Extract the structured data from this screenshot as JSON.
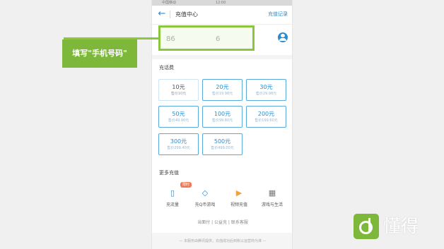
{
  "status": {
    "left": "中国移动",
    "time": "12:00"
  },
  "header": {
    "title": "充值中心",
    "record_label": "充值记录"
  },
  "phone": {
    "value": "86                  6"
  },
  "callout": {
    "label": "填写\"手机号码\"",
    "color": "#8cc63f"
  },
  "recharge": {
    "section_label": "充话费",
    "tiles": [
      {
        "amount": "10元",
        "sub": "售价10元"
      },
      {
        "amount": "20元",
        "sub": "售价19.98元"
      },
      {
        "amount": "30元",
        "sub": "售价29.98元"
      },
      {
        "amount": "50元",
        "sub": "售价49.90元"
      },
      {
        "amount": "100元",
        "sub": "售价99.80元"
      },
      {
        "amount": "200元",
        "sub": "售价199.60元"
      },
      {
        "amount": "300元",
        "sub": "售价299.40元"
      },
      {
        "amount": "500元",
        "sub": "售价499.00元"
      }
    ]
  },
  "more": {
    "section_label": "更多充值",
    "badge": "限时",
    "items": [
      {
        "label": "充流量",
        "icon": "phone-data-icon"
      },
      {
        "label": "充Q币游戏",
        "icon": "q-coin-icon"
      },
      {
        "label": "视频充值",
        "icon": "video-icon"
      },
      {
        "label": "游戏与生活",
        "icon": "grid-icon"
      }
    ]
  },
  "footer": {
    "links": "当面付 | 公益充 | 联系客服",
    "note": "— 本服务由腾讯提供，充值成功后到账以运营商为准 —"
  },
  "brand": {
    "text": "懂得"
  },
  "accent": "#2d8ccf"
}
